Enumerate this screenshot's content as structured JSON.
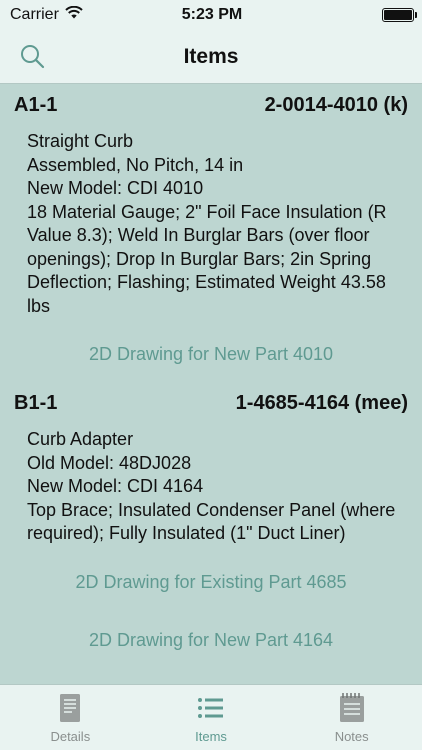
{
  "status": {
    "carrier": "Carrier",
    "time": "5:23 PM",
    "battery_level": 1.0
  },
  "nav": {
    "title": "Items"
  },
  "items": [
    {
      "id": "A1-1",
      "code": "2-0014-4010 (k)",
      "lines": [
        "Straight Curb",
        "Assembled, No Pitch, 14 in",
        "New Model: CDI 4010",
        "18 Material Gauge; 2\" Foil Face Insulation (R Value 8.3); Weld In Burglar Bars (over floor openings); Drop In Burglar Bars; 2in Spring Deflection; Flashing; Estimated Weight 43.58 lbs"
      ],
      "links": [
        "2D Drawing for New Part 4010"
      ]
    },
    {
      "id": "B1-1",
      "code": "1-4685-4164 (mee)",
      "lines": [
        "Curb Adapter",
        "Old Model: 48DJ028",
        "New Model: CDI 4164",
        "Top Brace; Insulated Condenser Panel (where required); Fully Insulated (1\" Duct Liner)"
      ],
      "links": [
        "2D Drawing for Existing Part 4685",
        "2D Drawing for New Part 4164"
      ]
    }
  ],
  "tabs": [
    {
      "label": "Details",
      "icon": "details-icon",
      "active": false
    },
    {
      "label": "Items",
      "icon": "list-icon",
      "active": true
    },
    {
      "label": "Notes",
      "icon": "notes-icon",
      "active": false
    }
  ],
  "colors": {
    "background": "#bdd6d1",
    "bar": "#e9f3f1",
    "accent": "#5f9a91",
    "inactive": "#8a8f8e"
  }
}
